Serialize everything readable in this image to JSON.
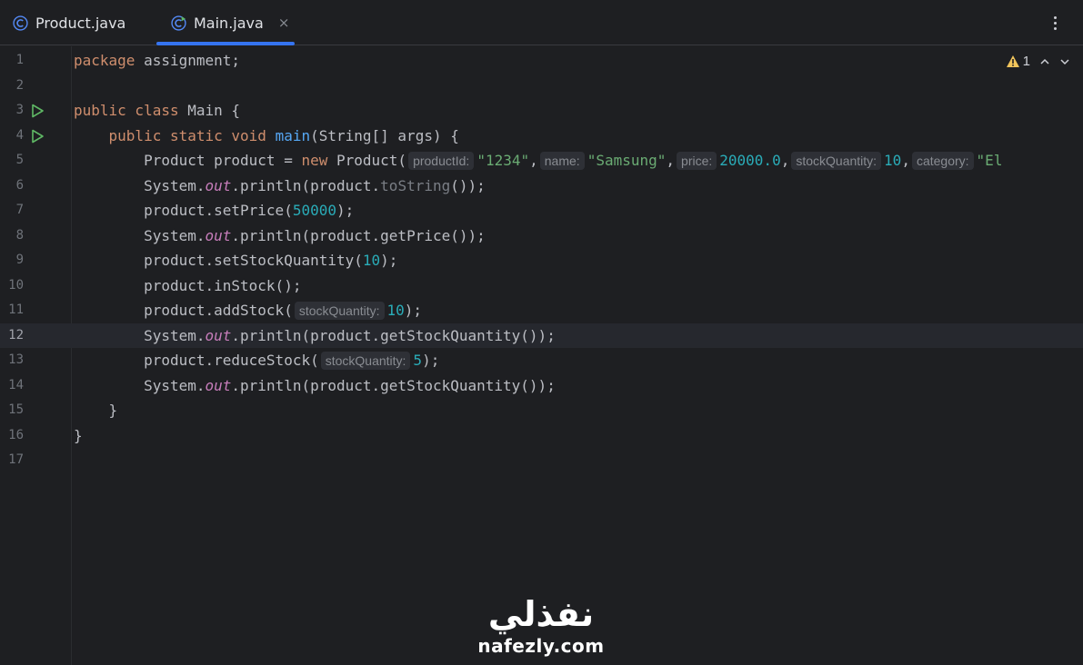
{
  "tabs": [
    {
      "label": "Product.java",
      "icon": "java-class-icon",
      "active": false
    },
    {
      "label": "Main.java",
      "icon": "java-class-run-icon",
      "active": true,
      "close": "×"
    }
  ],
  "editor": {
    "inspection": {
      "warning_count": "1",
      "icon": "warning-icon"
    },
    "current_line": 12,
    "lines": [
      {
        "n": "1"
      },
      {
        "n": "2"
      },
      {
        "n": "3"
      },
      {
        "n": "4"
      },
      {
        "n": "5"
      },
      {
        "n": "6"
      },
      {
        "n": "7"
      },
      {
        "n": "8"
      },
      {
        "n": "9"
      },
      {
        "n": "10"
      },
      {
        "n": "11"
      },
      {
        "n": "12"
      },
      {
        "n": "13"
      },
      {
        "n": "14"
      },
      {
        "n": "15"
      },
      {
        "n": "16"
      },
      {
        "n": "17"
      }
    ],
    "code": {
      "l1_kw": "package",
      "l1_rest": " assignment;",
      "l3_kw": "public class",
      "l3_rest": " Main {",
      "l4_indent": "    ",
      "l4_kw": "public static void",
      "l4_sp": " ",
      "l4_fn": "main",
      "l4_rest": "(String[] args) {",
      "l5_a": "        Product product = ",
      "l5_kw": "new",
      "l5_b": " Product(",
      "l5_h1": "productId:",
      "l5_s1": "\"1234\"",
      "l5_c1": ",",
      "l5_h2": "name:",
      "l5_s2": "\"Samsung\"",
      "l5_c2": ",",
      "l5_h3": "price:",
      "l5_n3": "20000.0",
      "l5_c3": ",",
      "l5_h4": "stockQuantity:",
      "l5_n4": "10",
      "l5_c4": ",",
      "l5_h5": "category:",
      "l5_s5": "\"El",
      "l6_a": "        System.",
      "l6_st": "out",
      "l6_b": ".println(product.",
      "l6_dim": "toString",
      "l6_c": "());",
      "l7_a": "        product.setPrice(",
      "l7_n": "50000",
      "l7_b": ");",
      "l8_a": "        System.",
      "l8_st": "out",
      "l8_b": ".println(product.getPrice());",
      "l9_a": "        product.setStockQuantity(",
      "l9_n": "10",
      "l9_b": ");",
      "l10": "        product.inStock();",
      "l11_a": "        product.addStock(",
      "l11_h": "stockQuantity:",
      "l11_n": "10",
      "l11_b": ");",
      "l12_a": "        System.",
      "l12_st": "out",
      "l12_b": ".println(product.getStockQuantity());",
      "l13_a": "        product.reduceStock(",
      "l13_h": "stockQuantity:",
      "l13_n": "5",
      "l13_b": ");",
      "l14_a": "        System.",
      "l14_st": "out",
      "l14_b": ".println(product.getStockQuantity());",
      "l15": "    }",
      "l16": "}"
    }
  },
  "watermark": {
    "arabic": "نفذلي",
    "latin": "nafezly.com"
  },
  "colors": {
    "background": "#1e1f22",
    "keyword": "#cf8e6d",
    "string": "#6aab73",
    "number": "#2aacb8",
    "function": "#56a8f5",
    "static_field": "#c77dbb",
    "tab_underline": "#3574f0",
    "run_icon": "#5fb865",
    "warning": "#f2c55c"
  }
}
